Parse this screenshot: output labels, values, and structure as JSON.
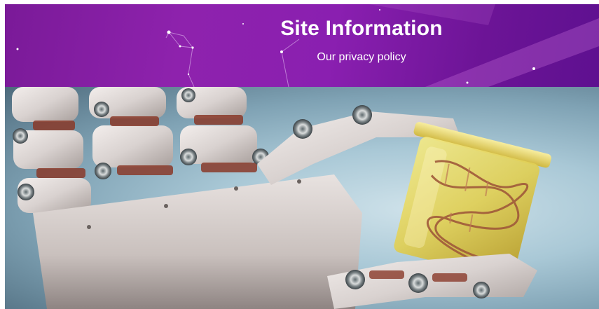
{
  "banner": {
    "title": "Site Information",
    "subtitle": "Our privacy policy",
    "background_color": "#8a1fb0"
  },
  "hero": {
    "image_subject": "robot-hand-holding-dna-jar-image"
  }
}
